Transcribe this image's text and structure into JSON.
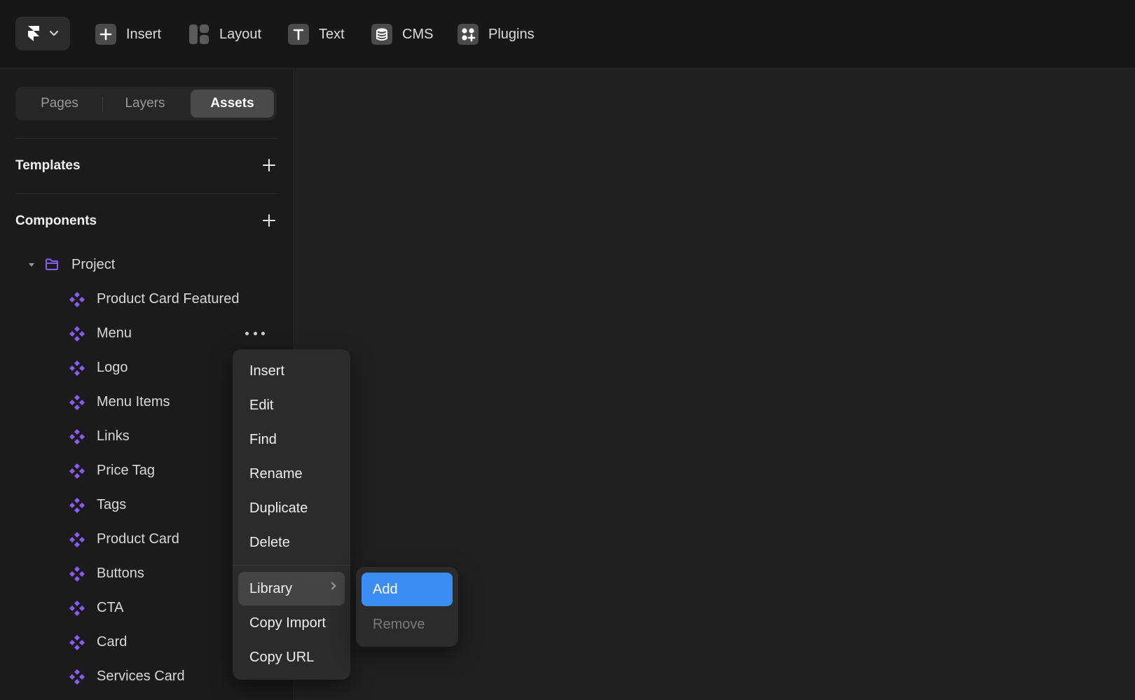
{
  "toolbar": {
    "items": [
      {
        "label": "Insert",
        "icon": "plus-square-icon"
      },
      {
        "label": "Layout",
        "icon": "layout-icon"
      },
      {
        "label": "Text",
        "icon": "text-t-icon"
      },
      {
        "label": "CMS",
        "icon": "database-icon"
      },
      {
        "label": "Plugins",
        "icon": "plugins-icon"
      }
    ]
  },
  "tabs": [
    {
      "label": "Pages",
      "active": false
    },
    {
      "label": "Layers",
      "active": false
    },
    {
      "label": "Assets",
      "active": true
    }
  ],
  "sections": {
    "templates": {
      "title": "Templates"
    },
    "components": {
      "title": "Components"
    }
  },
  "tree": {
    "folder": "Project",
    "components": [
      "Product Card Featured",
      "Menu",
      "Logo",
      "Menu Items",
      "Links",
      "Price Tag",
      "Tags",
      "Product Card",
      "Buttons",
      "CTA",
      "Card",
      "Services Card"
    ]
  },
  "context_menu": {
    "items": [
      "Insert",
      "Edit",
      "Find",
      "Rename",
      "Duplicate",
      "Delete"
    ],
    "library": "Library",
    "bottom_items": [
      "Copy Import",
      "Copy URL"
    ]
  },
  "submenu": {
    "add": "Add",
    "remove": "Remove"
  },
  "colors": {
    "accent": "#3b8df4",
    "component": "#8a5cf6"
  }
}
